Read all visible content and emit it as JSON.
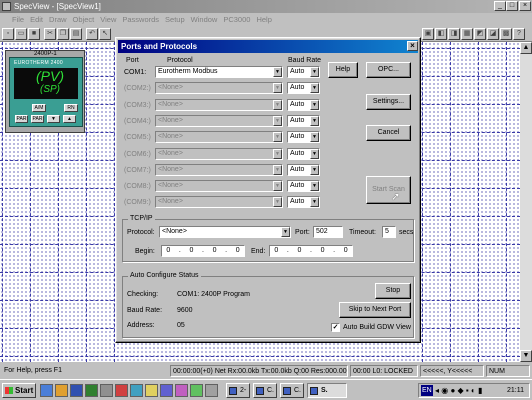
{
  "window": {
    "title": "SpecView - [SpecView1]"
  },
  "menu": [
    "File",
    "Edit",
    "Draw",
    "Object",
    "View",
    "Passwords",
    "Setup",
    "Window",
    "PC3000",
    "Help"
  ],
  "instrument": {
    "tag": "2400P-1",
    "brand": "EUROTHERM 2400",
    "pv": "(PV)",
    "sp": "(SP)",
    "btn_left": "A/M",
    "btn_right": "RN",
    "btn_page1": "PAR",
    "btn_page2": "PAR",
    "btn_down": "▼",
    "btn_up": "▲"
  },
  "dialog": {
    "title": "Ports and Protocols",
    "col_port": "Port",
    "col_protocol": "Protocol",
    "col_baud": "Baud Rate",
    "ports": [
      {
        "name": "COM1:",
        "protocol": "Eurotherm Modbus",
        "baud": "Auto",
        "enabled": true
      },
      {
        "name": "(COM2:)",
        "protocol": "<None>",
        "baud": "Auto",
        "enabled": false
      },
      {
        "name": "(COM3:)",
        "protocol": "<None>",
        "baud": "Auto",
        "enabled": false
      },
      {
        "name": "(COM4:)",
        "protocol": "<None>",
        "baud": "Auto",
        "enabled": false
      },
      {
        "name": "(COM5:)",
        "protocol": "<None>",
        "baud": "Auto",
        "enabled": false
      },
      {
        "name": "(COM6:)",
        "protocol": "<None>",
        "baud": "Auto",
        "enabled": false
      },
      {
        "name": "(COM7:)",
        "protocol": "<None>",
        "baud": "Auto",
        "enabled": false
      },
      {
        "name": "(COM8:)",
        "protocol": "<None>",
        "baud": "Auto",
        "enabled": false
      },
      {
        "name": "(COM9:)",
        "protocol": "<None>",
        "baud": "Auto",
        "enabled": false
      }
    ],
    "help_label": "Help",
    "opc_label": "OPC...",
    "settings_label": "Settings...",
    "cancel_label": "Cancel",
    "start_scan_label": "Start Scan",
    "tcpip": {
      "title": "TCP/IP",
      "protocol_label": "Protocol:",
      "protocol_value": "<None>",
      "port_label": "Port:",
      "port_value": "502",
      "timeout_label": "Timeout:",
      "timeout_value": "5",
      "timeout_unit": "secs",
      "begin_label": "Begin:",
      "begin_octets": [
        "0",
        "0",
        "0",
        "0"
      ],
      "end_label": "End:",
      "end_octets": [
        "0",
        "0",
        "0",
        "0"
      ]
    },
    "autoconfig": {
      "title": "Auto Configure Status",
      "checking_label": "Checking:",
      "checking_value": "COM1: 2400P Program",
      "baud_label": "Baud Rate:",
      "baud_value": "9600",
      "address_label": "Address:",
      "address_value": "05",
      "stop_label": "Stop",
      "skip_label": "Skip to Next Port",
      "autobuild_label": "Auto Build GDW View",
      "autobuild_checked": true
    }
  },
  "statusbar": {
    "help": "For Help, press F1",
    "comms": "00:00:00(+0) Net Rx:00.0kb Tx:00.0kb Q:00 Res:000.00",
    "lock": "00:00 L0: LOCKED",
    "coords": "<<<<<, Y<<<<<",
    "num": "NUM"
  },
  "taskbar": {
    "start": "Start",
    "tasks": [
      "2-",
      "C.",
      "C.",
      "S."
    ],
    "lang": "EN",
    "clock": "21:11"
  }
}
